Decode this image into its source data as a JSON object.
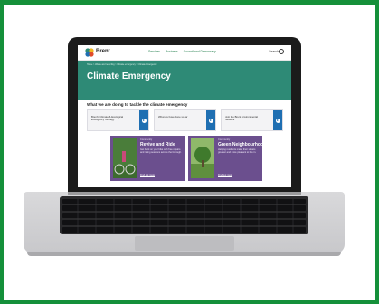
{
  "site": {
    "brand": "Brent",
    "nav_links": [
      "Services",
      "Business",
      "Council and Democracy"
    ],
    "search_label": "Search",
    "breadcrumb": "Home > Waste and recycling > Climate emergency > Climate Emergency",
    "page_title": "Climate Emergency",
    "section_title": "What we are doing to tackle the climate emergency",
    "cards": [
      {
        "label": "Brent's Climate & Ecological Emergency Strategy"
      },
      {
        "label": "What we have done so far"
      },
      {
        "label": "Join the Brent Environmental Network"
      }
    ],
    "features": [
      {
        "category": "Community",
        "title": "Revive and Ride",
        "description": "Get back on your bike with free repairs and riding sessions across the borough.",
        "link": "Find out more"
      },
      {
        "category": "Community",
        "title": "Green Neighbourhoods",
        "description": "Helping residents make their streets greener and more pleasant to live in.",
        "link": "Find out more"
      }
    ]
  },
  "colors": {
    "background": "#15903a",
    "hero": "#2e8a76",
    "card_button": "#1f6fb2",
    "feature": "#6b4f8e"
  }
}
